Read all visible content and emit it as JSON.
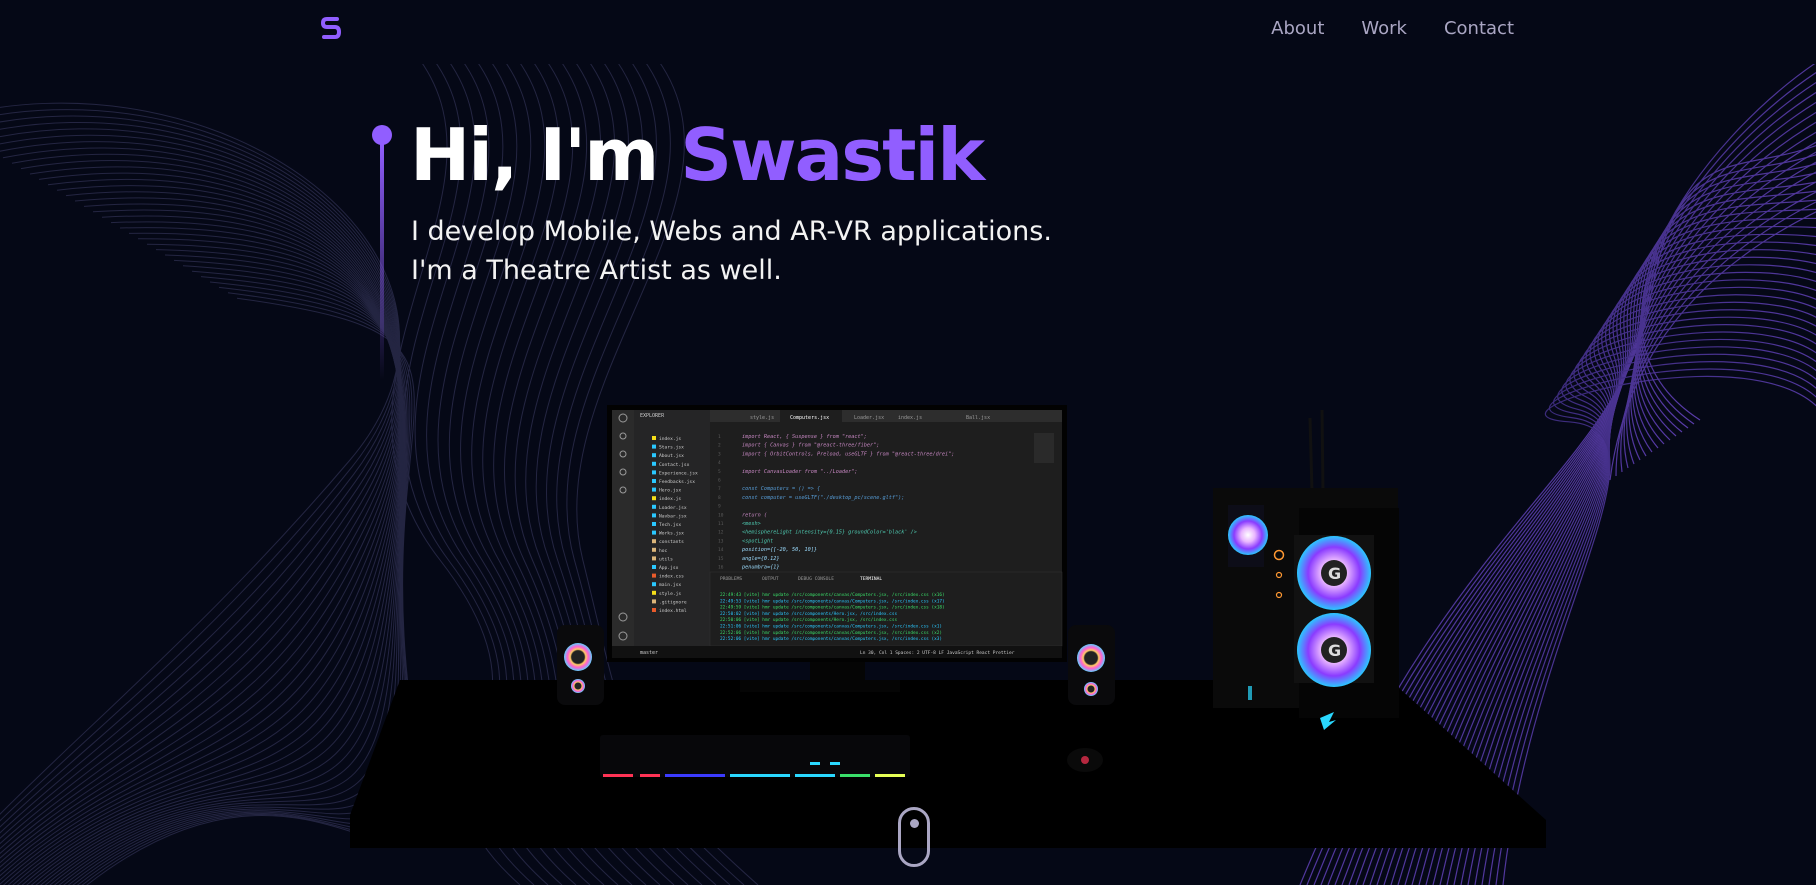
{
  "navbar": {
    "logo_icon": "s-logo-icon",
    "links": [
      {
        "label": "About"
      },
      {
        "label": "Work"
      },
      {
        "label": "Contact"
      }
    ]
  },
  "hero": {
    "title_prefix": "Hi, I'm ",
    "title_name": "Swastik",
    "subtitle_line1": "I develop Mobile, Webs and AR-VR applications.",
    "subtitle_line2": "I'm a Theatre Artist as well."
  },
  "editor": {
    "tabs": [
      "style.js",
      "Computers.jsx",
      "Loader.jsx",
      "index.js",
      "Ball.jsx"
    ],
    "explorer_title": "EXPLORER",
    "files": [
      "index.js",
      "Stars.jsx",
      "About.jsx",
      "Contact.jsx",
      "Experience.jsx",
      "Feedbacks.jsx",
      "Hero.jsx",
      "index.js",
      "Loader.jsx",
      "Navbar.jsx",
      "Tech.jsx",
      "Works.jsx",
      "constants",
      "hoc",
      "utils",
      "App.jsx",
      "index.css",
      "main.jsx",
      "style.js",
      ".gitignore",
      "index.html"
    ],
    "code_lines": [
      "import React, { Suspense } from \"react\";",
      "import { Canvas } from \"@react-three/fiber\";",
      "import { OrbitControls, Preload, useGLTF } from \"@react-three/drei\";",
      "",
      "import CanvasLoader from \"../Loader\";",
      "",
      "const Computers = () => {",
      "  const computer = useGLTF(\"./desktop_pc/scene.gltf\");",
      "",
      "  return (",
      "    <mesh>",
      "      <hemisphereLight intensity={0.15} groundColor='black' />",
      "      <spotLight",
      "        position={[-20, 50, 10]}",
      "        angle={0.12}",
      "        penumbra={1}"
    ],
    "panel_tabs": [
      "PROBLEMS",
      "OUTPUT",
      "DEBUG CONSOLE",
      "TERMINAL"
    ],
    "terminal_lines": [
      "22:49:43 [vite] hmr update /src/components/canvas/Computers.jsx, /src/index.css (x16)",
      "22:49:53 [vite] hmr update /src/components/canvas/Computers.jsx, /src/index.css (x17)",
      "22:49:59 [vite] hmr update /src/components/canvas/Computers.jsx, /src/index.css (x18)",
      "22:50:02 [vite] hmr update /src/components/Hero.jsx, /src/index.css",
      "22:50:06 [vite] hmr update /src/components/Hero.jsx, /src/index.css",
      "22:51:06 [vite] hmr update /src/components/canvas/Computers.jsx, /src/index.css (x1)",
      "22:52:06 [vite] hmr update /src/components/canvas/Computers.jsx, /src/index.css (x2)",
      "22:52:06 [vite] hmr update /src/components/canvas/Computers.jsx, /src/index.css (x3)"
    ],
    "status_left": "master",
    "status_right": "Ln 30, Col 1   Spaces: 2   UTF-8   LF   JavaScript React   Prettier"
  },
  "scroll_indicator": {
    "icon": "mouse-scroll-icon"
  },
  "colors": {
    "background": "#050816",
    "accent": "#915eff",
    "text": "#ffffff",
    "secondary": "#aaa6c3"
  }
}
